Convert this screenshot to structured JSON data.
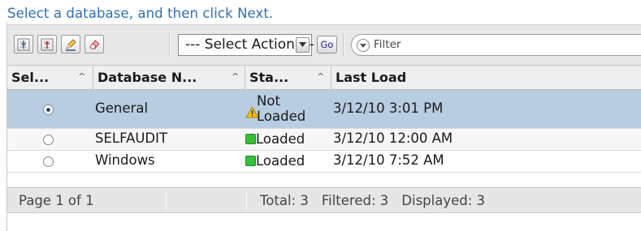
{
  "instruction": "Select a database, and then click Next.",
  "toolbar": {
    "icons": [
      "expand-all-icon",
      "collapse-all-icon",
      "edit-pencil-icon",
      "eraser-icon"
    ],
    "select_action": {
      "selected": "--- Select Action ---"
    },
    "go_label": "Go",
    "filter_placeholder": "Filter"
  },
  "table": {
    "columns": [
      {
        "label": "Sel...",
        "sort": "^"
      },
      {
        "label": "Database N...",
        "sort": "^"
      },
      {
        "label": "Sta...",
        "sort": "^"
      },
      {
        "label": "Last Load",
        "sort": ""
      }
    ],
    "rows": [
      {
        "selected": true,
        "database": "General",
        "status": "Not Loaded",
        "status_line1": "Not",
        "status_line2": "Loaded",
        "status_icon": "warning-icon",
        "last_load": "3/12/10 3:01 PM"
      },
      {
        "selected": false,
        "database": "SELFAUDIT",
        "status": "Loaded",
        "status_icon": "loaded-status-icon",
        "last_load": "3/12/10 12:00 AM"
      },
      {
        "selected": false,
        "database": "Windows",
        "status": "Loaded",
        "status_icon": "loaded-status-icon",
        "last_load": "3/12/10 7:52 AM"
      }
    ]
  },
  "footer": {
    "page": "Page 1 of 1",
    "total": "Total: 3",
    "filtered": "Filtered: 3",
    "displayed": "Displayed: 3"
  },
  "colors": {
    "instruction_text": "#2f6fb7",
    "selected_row": "#b8cde1",
    "loaded_status": "#37c13a",
    "warning": "#f2c200"
  }
}
